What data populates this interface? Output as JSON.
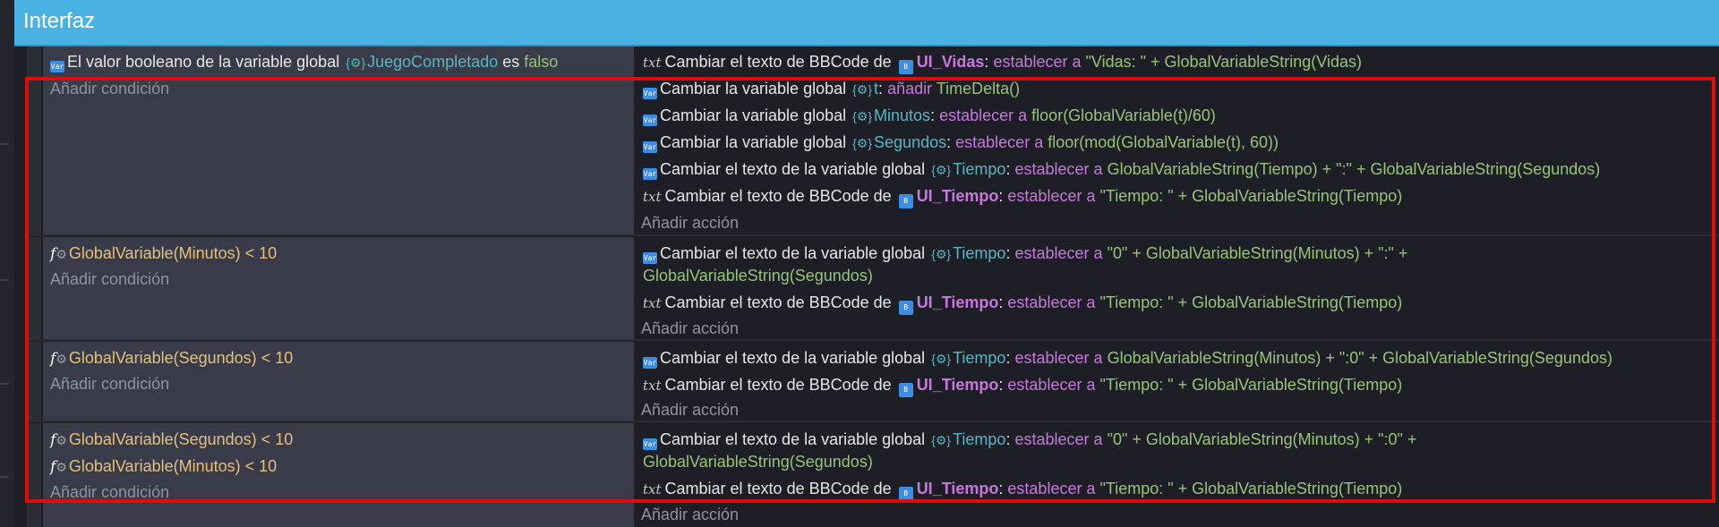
{
  "group": {
    "title": "Interfaz"
  },
  "labels": {
    "add_condition": "Añadir condición",
    "add_action": "Añadir acción",
    "set": "establecer a",
    "add": "añadir",
    "colon": ":",
    "lt": "<",
    "ten": "10",
    "change_global": "Cambiar la variable global",
    "change_text_global": "Cambiar el texto de la variable global",
    "change_bbcode": "Cambiar el texto de BBCode de"
  },
  "events": [
    {
      "condition": {
        "prefix": "El valor booleano de la variable global",
        "variable": "JuegoCompletado",
        "mid": "es",
        "value": "falso"
      },
      "actions": {
        "a1_object": "UI_Vidas",
        "a1_expr": "\"Vidas: \" + GlobalVariableString(Vidas)",
        "a2_variable": "t",
        "a2_expr": "TimeDelta()",
        "a3_variable": "Minutos",
        "a3_expr": "floor(GlobalVariable(t)/60)",
        "a4_variable": "Segundos",
        "a4_expr": "floor(mod(GlobalVariable(t), 60))",
        "a5_variable": "Tiempo",
        "a5_expr": "GlobalVariableString(Tiempo) + \":\" + GlobalVariableString(Segundos)",
        "a6_object": "UI_Tiempo",
        "a6_expr": "\"Tiempo: \" + GlobalVariableString(Tiempo)"
      }
    },
    {
      "condition": {
        "expr": "GlobalVariable(Minutos)"
      },
      "actions": {
        "a1_variable": "Tiempo",
        "a1_expr_line1": "\"0\" + GlobalVariableString(Minutos) + \":\" +",
        "a1_expr_line2": "GlobalVariableString(Segundos)",
        "a2_object": "UI_Tiempo",
        "a2_expr": "\"Tiempo: \" + GlobalVariableString(Tiempo)"
      }
    },
    {
      "condition": {
        "expr": "GlobalVariable(Segundos)"
      },
      "actions": {
        "a1_variable": "Tiempo",
        "a1_expr": "GlobalVariableString(Minutos) + \":0\" + GlobalVariableString(Segundos)",
        "a2_object": "UI_Tiempo",
        "a2_expr": "\"Tiempo: \" + GlobalVariableString(Tiempo)"
      }
    },
    {
      "conditions": {
        "c1_expr": "GlobalVariable(Segundos)",
        "c2_expr": "GlobalVariable(Minutos)"
      },
      "actions": {
        "a1_variable": "Tiempo",
        "a1_expr_line1": "\"0\" + GlobalVariableString(Minutos) + \":0\" +",
        "a1_expr_line2": "GlobalVariableString(Segundos)",
        "a2_object": "UI_Tiempo",
        "a2_expr": "\"Tiempo: \" + GlobalVariableString(Tiempo)"
      }
    }
  ],
  "colors": {
    "header": "#4ab2e3",
    "highlight": "#e10b0b",
    "keyword": "#c678dd",
    "value": "#98c379",
    "variable": "#56b6c2",
    "condition": "#e5c07b"
  }
}
